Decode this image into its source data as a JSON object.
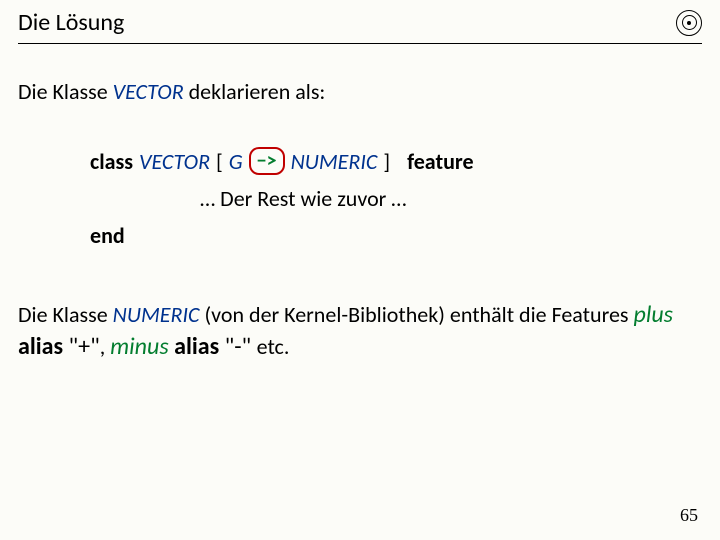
{
  "header": {
    "title": "Die Lösung"
  },
  "intro": {
    "pre": "Die Klasse ",
    "vector": "VECTOR",
    "post": "  deklarieren als:"
  },
  "code": {
    "class_kw": "class",
    "vector": "VECTOR",
    "bracket_open": "[",
    "g": "G",
    "arrow": "−>",
    "numeric": "NUMERIC",
    "bracket_close": "]",
    "feature_kw": "feature",
    "rest": "… Der Rest wie zuvor …",
    "end_kw": "end"
  },
  "para2": {
    "t1": "Die Klasse ",
    "numeric": "NUMERIC",
    "t2": " (von der Kernel-Bibliothek) enthält die Features ",
    "f1": "plus ",
    "a1": "alias",
    "q1": " \"+\"",
    "comma": ", ",
    "f2": "minus ",
    "a2": "alias",
    "q2": " \"-\" ",
    "etc": " etc."
  },
  "page": "65"
}
